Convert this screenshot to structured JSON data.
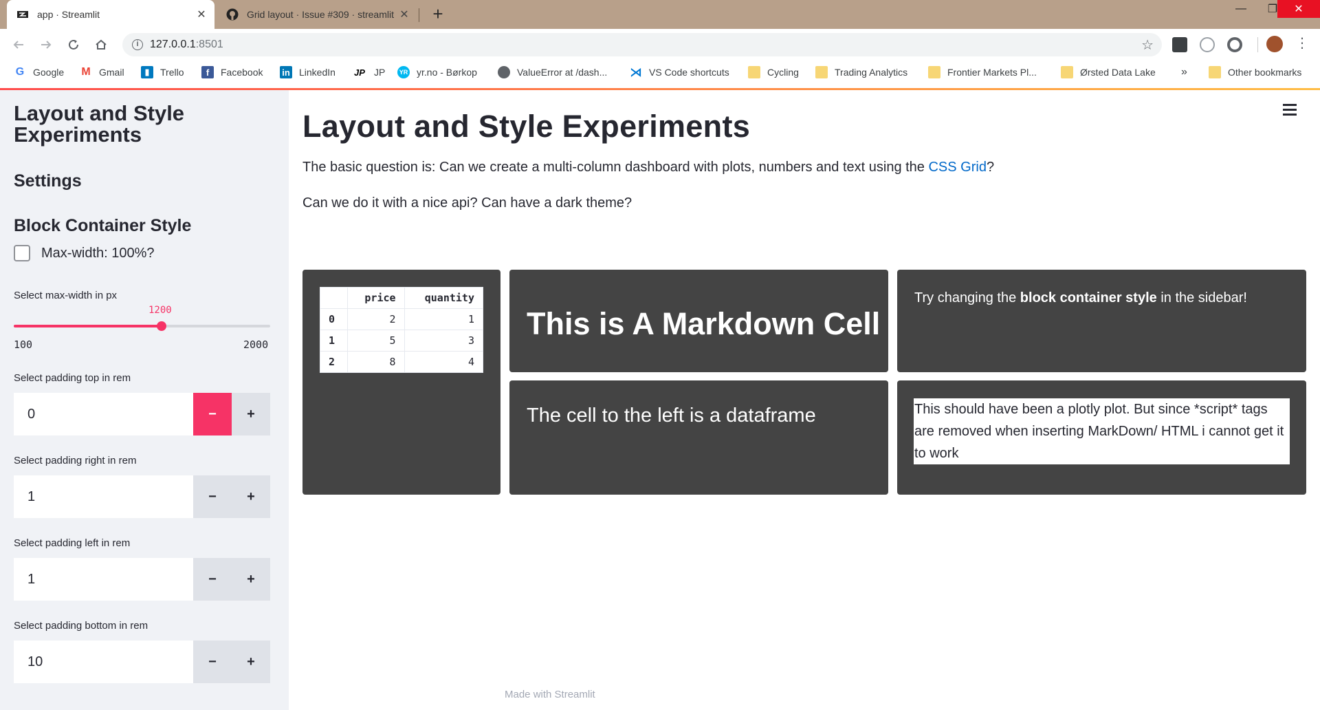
{
  "browser": {
    "tabs": [
      {
        "title": "app · Streamlit",
        "close": "✕"
      },
      {
        "title": "Grid layout · Issue #309 · streamlit",
        "close": "✕"
      }
    ],
    "new_tab": "+",
    "window_controls": {
      "minimize": "—",
      "maximize": "❐",
      "close": "✕"
    },
    "url_host": "127.0.0.1",
    "url_port": ":8501",
    "bookmarks": [
      {
        "label": "Google",
        "icon": "google-icon",
        "color": "#4285f4"
      },
      {
        "label": "Gmail",
        "icon": "gmail-icon",
        "color": "#ea4335"
      },
      {
        "label": "Trello",
        "icon": "trello-icon",
        "color": "#0079bf"
      },
      {
        "label": "Facebook",
        "icon": "facebook-icon",
        "color": "#3b5998"
      },
      {
        "label": "LinkedIn",
        "icon": "linkedin-icon",
        "color": "#0077b5"
      },
      {
        "label": "JP",
        "icon": "jp-icon",
        "color": "#000000"
      },
      {
        "label": "yr.no - Børkop",
        "icon": "yr-icon",
        "color": "#00b8f1"
      },
      {
        "label": "ValueError at /dash...",
        "icon": "globe-icon",
        "color": "#5f6368"
      },
      {
        "label": "VS Code shortcuts",
        "icon": "vscode-icon",
        "color": "#0078d4"
      },
      {
        "label": "Cycling",
        "icon": "folder-icon",
        "color": "#f7d675"
      },
      {
        "label": "Trading Analytics",
        "icon": "folder-icon",
        "color": "#f7d675"
      },
      {
        "label": "Frontier Markets Pl...",
        "icon": "folder-icon",
        "color": "#f7d675"
      },
      {
        "label": "Ørsted Data Lake",
        "icon": "folder-icon",
        "color": "#f7d675"
      }
    ],
    "bookmarks_overflow": "»",
    "other_bookmarks": "Other bookmarks"
  },
  "sidebar": {
    "title": "Layout and Style Experiments",
    "settings_heading": "Settings",
    "block_heading": "Block Container Style",
    "max_width_checkbox": "Max-width: 100%?",
    "slider": {
      "label": "Select max-width in px",
      "value": "1200",
      "min": "100",
      "max": "2000",
      "fraction": 0.579
    },
    "inputs": [
      {
        "label": "Select padding top in rem",
        "value": "0"
      },
      {
        "label": "Select padding right in rem",
        "value": "1"
      },
      {
        "label": "Select padding left in rem",
        "value": "1"
      },
      {
        "label": "Select padding bottom in rem",
        "value": "10"
      }
    ],
    "minus": "−",
    "plus": "+"
  },
  "main": {
    "title": "Layout and Style Experiments",
    "para1_before": "The basic question is: Can we create a multi-column dashboard with plots, numbers and text using the ",
    "para1_link": "CSS Grid",
    "para1_after": "?",
    "para2": "Can we do it with a nice api? Can have a dark theme?",
    "dataframe": {
      "columns": [
        "price",
        "quantity"
      ],
      "rows": [
        {
          "index": "0",
          "price": "2",
          "quantity": "1"
        },
        {
          "index": "1",
          "price": "5",
          "quantity": "3"
        },
        {
          "index": "2",
          "price": "8",
          "quantity": "4"
        }
      ]
    },
    "markdown_heading": "This is A Markdown Cell",
    "try_before": "Try changing the ",
    "try_bold": "block container style",
    "try_after": " in the sidebar!",
    "left_cell_text": "The cell to the left is a dataframe",
    "plot_text": "This should have been a plotly plot. But since *script* tags are removed when inserting MarkDown/ HTML i cannot get it to work",
    "footer": "Made with Streamlit"
  },
  "colors": {
    "accent": "#f63366",
    "cell_bg": "#444444",
    "sidebar_bg": "#f0f2f6",
    "link": "#0068c9"
  }
}
